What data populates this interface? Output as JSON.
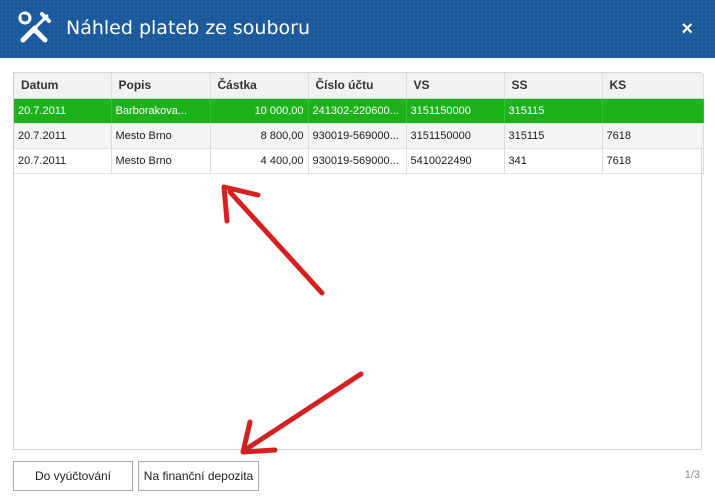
{
  "window": {
    "title": "Náhled plateb ze souboru",
    "close_glyph": "×"
  },
  "table": {
    "columns": [
      "Datum",
      "Popis",
      "Částka",
      "Číslo účtu",
      "VS",
      "SS",
      "KS"
    ],
    "rows": [
      [
        "20.7.2011",
        "Barborakova...",
        "10 000,00",
        "241302-220600...",
        "3151150000",
        "315115",
        ""
      ],
      [
        "20.7.2011",
        "Mesto Brno",
        "8 800,00",
        "930019-569000...",
        "3151150000",
        "315115",
        "7618"
      ],
      [
        "20.7.2011",
        "Mesto Brno",
        "4 400,00",
        "930019-569000...",
        "5410022490",
        "341",
        "7618"
      ]
    ],
    "selected_row": 0
  },
  "footer": {
    "button_1": "Do vyúčtování",
    "button_2": "Na finanční depozita",
    "pager": "1/3"
  },
  "colors": {
    "titlebar": "#1a5a9c",
    "selected_row": "#1bb21b",
    "annotation_arrow": "#d42020"
  },
  "icons": {
    "title_icon": "wrench-screwdriver-icon",
    "close_icon": "close-icon"
  }
}
